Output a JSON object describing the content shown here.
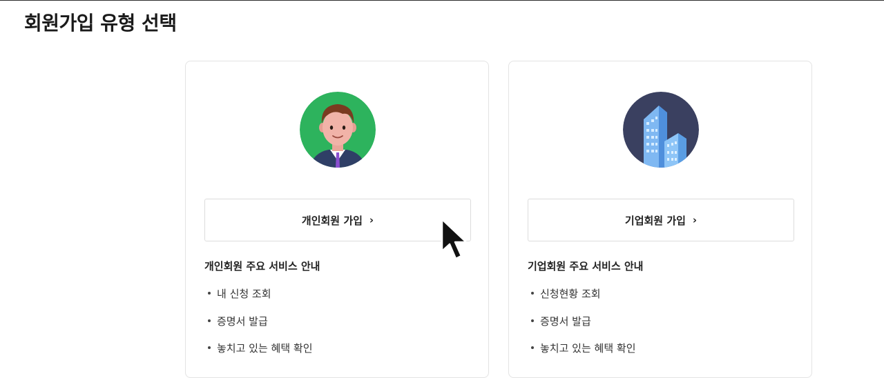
{
  "page": {
    "title": "회원가입 유형 선택"
  },
  "cards": {
    "personal": {
      "avatar_icon": "person-avatar-icon",
      "avatar_bg": "#2db35d",
      "join_label": "개인회원 가입",
      "chevron": "›",
      "section_title": "개인회원 주요 서비스 안내",
      "services": [
        "내 신청 조회",
        "증명서 발급",
        "놓치고 있는 혜택 확인"
      ]
    },
    "corporate": {
      "avatar_icon": "buildings-icon",
      "avatar_bg": "#3a4060",
      "join_label": "기업회원 가입",
      "chevron": "›",
      "section_title": "기업회원 주요 서비스 안내",
      "services": [
        "신청현황 조회",
        "증명서 발급",
        "놓치고 있는 혜택 확인"
      ]
    }
  },
  "cursor": {
    "icon": "mouse-pointer-icon"
  }
}
